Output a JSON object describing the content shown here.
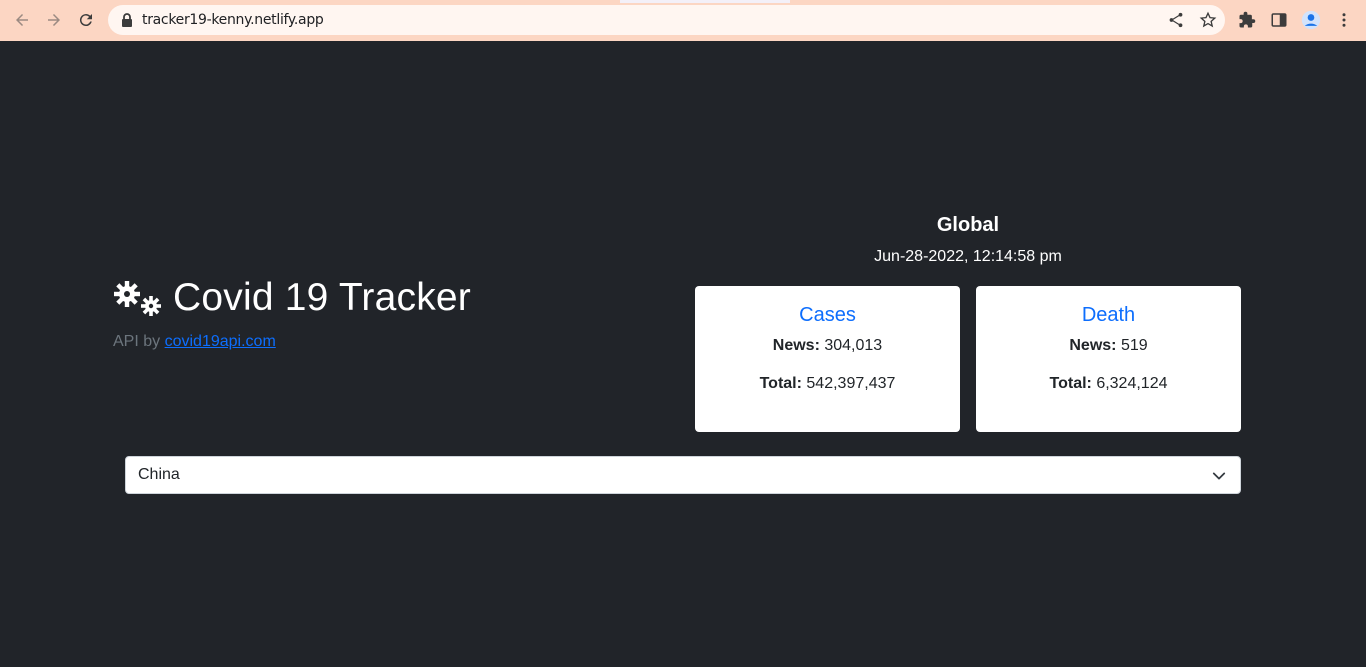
{
  "browser": {
    "url": "tracker19-kenny.netlify.app",
    "icons": [
      "back-icon",
      "forward-icon",
      "reload-icon",
      "lock-icon",
      "share-icon",
      "star-icon",
      "extensions-icon",
      "side-panel-icon",
      "profile-icon",
      "menu-icon"
    ]
  },
  "hero": {
    "title": "Covid 19 Tracker",
    "api_prefix": "API by",
    "api_link": "covid19api.com"
  },
  "global": {
    "title": "Global",
    "date": "Jun-28-2022, 12:14:58 pm"
  },
  "cards": [
    {
      "title": "Cases",
      "news_label": "News:",
      "news_value": "304,013",
      "total_label": "Total:",
      "total_value": "542,397,437"
    },
    {
      "title": "Death",
      "news_label": "News:",
      "news_value": "519",
      "total_label": "Total:",
      "total_value": "6,324,124"
    }
  ],
  "country_select": {
    "selected": "China"
  },
  "colors": {
    "background": "#212429",
    "accent": "#0d6efd",
    "chrome": "#fcd6c3"
  }
}
